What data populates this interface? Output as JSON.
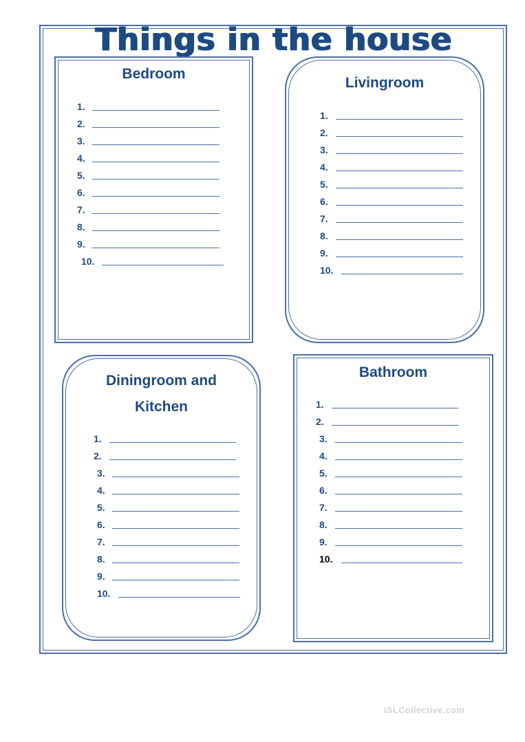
{
  "title": "Things in the house",
  "sections": {
    "bedroom": {
      "heading": "Bedroom",
      "items": [
        "1.",
        "2.",
        "3.",
        "4.",
        "5.",
        "6.",
        "7.",
        "8.",
        "9.",
        "10."
      ]
    },
    "livingroom": {
      "heading": "Livingroom",
      "items": [
        "1.",
        "2.",
        "3.",
        "4.",
        "5.",
        "6.",
        "7.",
        "8.",
        "9.",
        "10."
      ]
    },
    "dining": {
      "heading_line1": "Diningroom and",
      "heading_line2": "Kitchen",
      "items": [
        "1.",
        "2.",
        "3.",
        "4.",
        "5.",
        "6.",
        "7.",
        "8.",
        "9.",
        "10."
      ]
    },
    "bathroom": {
      "heading": "Bathroom",
      "items": [
        "1.",
        "2.",
        "3.",
        "4.",
        "5.",
        "6.",
        "7.",
        "8.",
        "9.",
        "10."
      ]
    }
  },
  "watermark": "iSLCollective.com",
  "colors": {
    "accent": "#1e4a82",
    "border": "#4a6fa8",
    "last_item_bathroom": "#000000"
  }
}
